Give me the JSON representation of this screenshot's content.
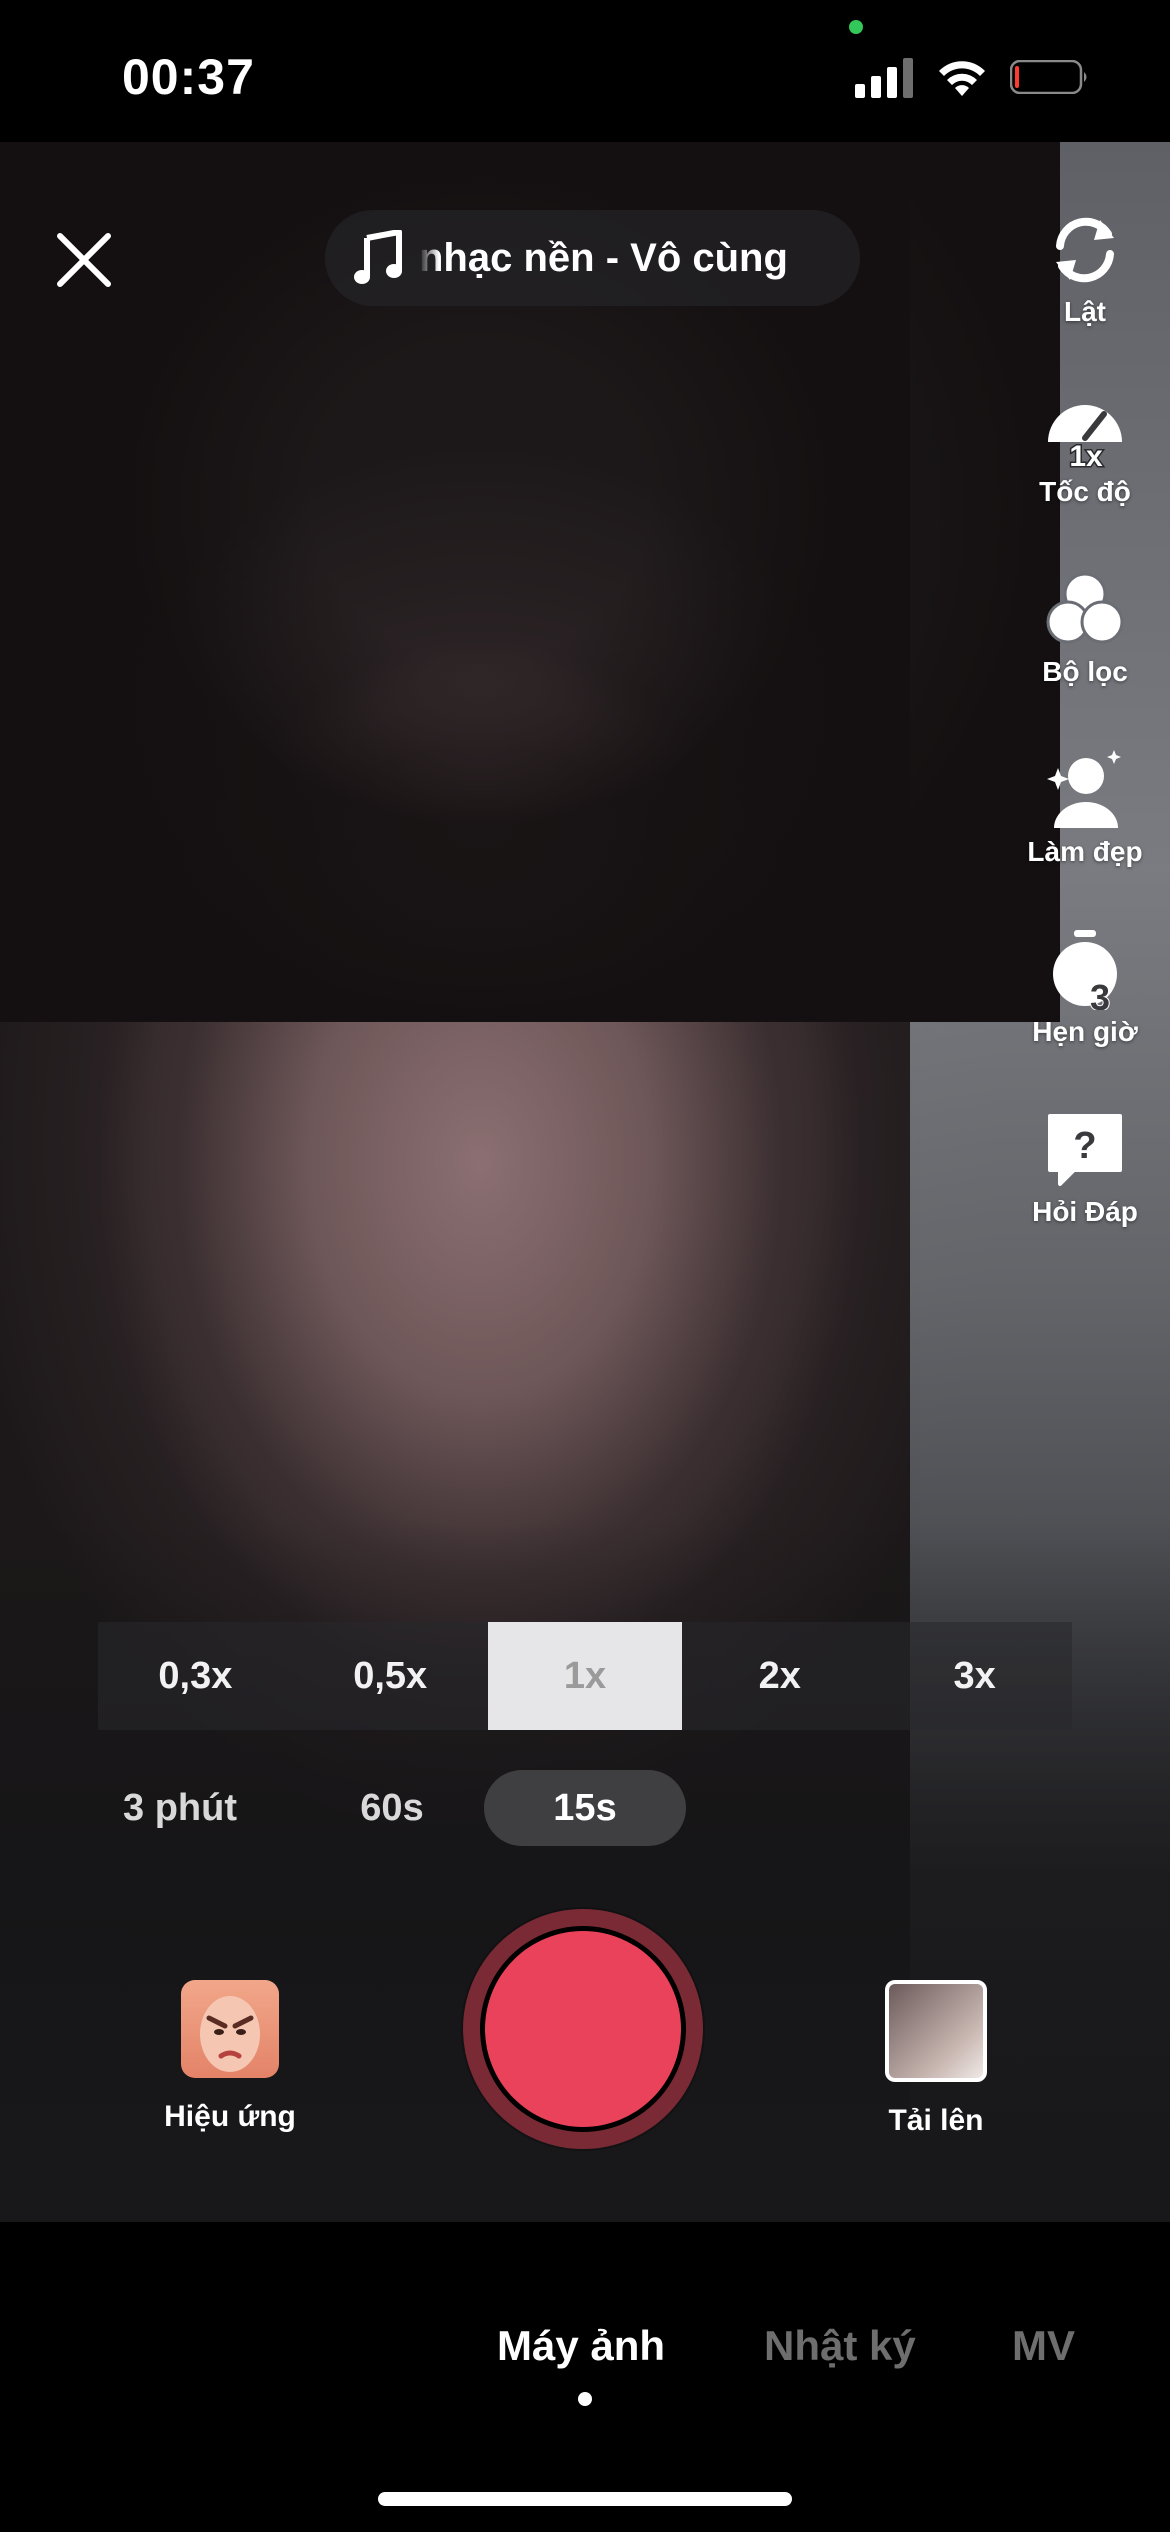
{
  "status_bar": {
    "time": "00:37"
  },
  "camera": {
    "sound_label": "nhạc nền - Vô cùng",
    "tools": [
      {
        "name": "flip",
        "label": "Lật",
        "icon": "flip-camera-icon"
      },
      {
        "name": "speed",
        "label": "Tốc độ",
        "icon": "speed-icon",
        "badge": "1x"
      },
      {
        "name": "filters",
        "label": "Bộ lọc",
        "icon": "filters-icon"
      },
      {
        "name": "beauty",
        "label": "Làm đẹp",
        "icon": "beauty-icon"
      },
      {
        "name": "timer",
        "label": "Hẹn giờ",
        "icon": "timer-icon",
        "badge": "3"
      },
      {
        "name": "qa",
        "label": "Hỏi Đáp",
        "icon": "question-icon"
      }
    ],
    "zoom_options": [
      "0,3x",
      "0,5x",
      "1x",
      "2x",
      "3x"
    ],
    "zoom_selected": "1x",
    "durations": [
      "3 phút",
      "60s",
      "15s"
    ],
    "duration_selected": "15s",
    "effects_label": "Hiệu ứng",
    "upload_label": "Tải lên"
  },
  "modes": {
    "items": [
      "Máy ảnh",
      "Nhật ký",
      "MV"
    ],
    "selected": "Máy ảnh"
  },
  "colors": {
    "record": "#e9425a",
    "record_ring": "#7a2a34",
    "status_green": "#34c759"
  }
}
